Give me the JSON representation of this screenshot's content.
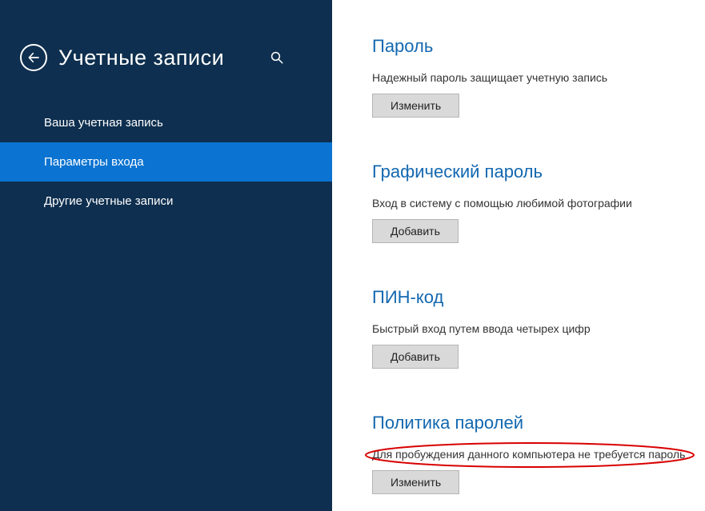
{
  "sidebar": {
    "title": "Учетные записи",
    "items": [
      {
        "label": "Ваша учетная запись"
      },
      {
        "label": "Параметры входа"
      },
      {
        "label": "Другие учетные записи"
      }
    ]
  },
  "sections": {
    "password": {
      "heading": "Пароль",
      "desc": "Надежный пароль защищает учетную запись",
      "button": "Изменить"
    },
    "picture": {
      "heading": "Графический пароль",
      "desc": "Вход в систему с помощью любимой фотографии",
      "button": "Добавить"
    },
    "pin": {
      "heading": "ПИН-код",
      "desc": "Быстрый вход путем ввода четырех цифр",
      "button": "Добавить"
    },
    "policy": {
      "heading": "Политика паролей",
      "desc": "Для пробуждения данного компьютера не требуется пароль",
      "button": "Изменить"
    }
  }
}
